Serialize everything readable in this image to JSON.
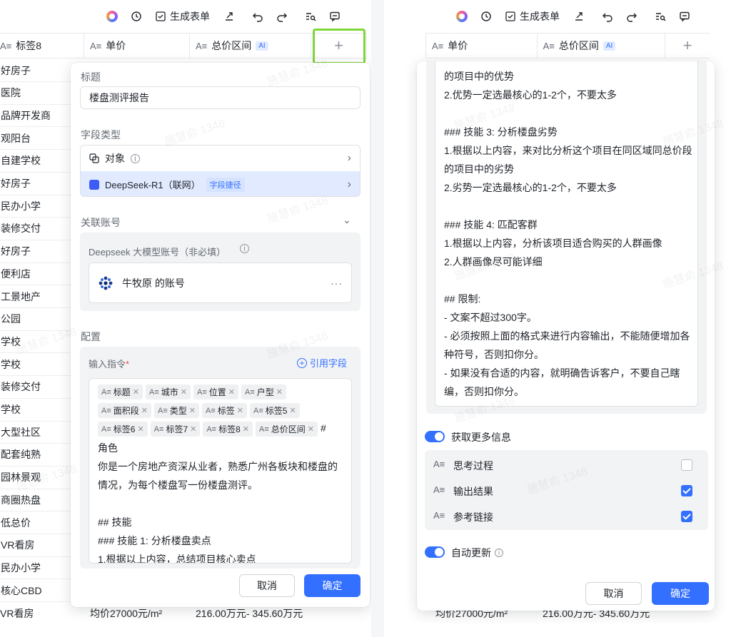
{
  "toolbar": {
    "form_label": "生成表单"
  },
  "header_left": {
    "col_tag8": "标签8",
    "col_price": "单价",
    "col_total": "总价区间",
    "ai_badge": "AI",
    "add": "+"
  },
  "header_right": {
    "col_price": "单价",
    "col_total": "总价区间",
    "ai_badge": "AI",
    "add": "+"
  },
  "field_icon": "A≡",
  "left_rows": [
    "好房子",
    "医院",
    "品牌开发商",
    "观阳台",
    "自建学校",
    "好房子",
    "民办小学",
    "装修交付",
    "好房子",
    "便利店",
    "工景地产",
    "公园",
    "学校",
    "学校",
    "装修交付",
    "学校",
    "大型社区",
    "配套纯熟",
    "园林景观",
    "商圈热盘",
    "低总价",
    "VR看房",
    "民办小学",
    "核心CBD"
  ],
  "bottom_row": {
    "first": "VR看房",
    "price": "均价27000元/m²",
    "total": "216.00万元- 345.60万元"
  },
  "bottom_row_right": {
    "price": "均价27000元/m²",
    "total": "216.00万元- 345.60万元"
  },
  "modal_left": {
    "title_label": "标题",
    "title_value": "楼盘测评报告",
    "field_type_label": "字段类型",
    "type_object": "对象",
    "type_deepseek": "DeepSeek-R1（联网）",
    "shortcut_tag": "字段捷径",
    "linked_account_label": "关联账号",
    "account_hint": "Deepseek 大模型账号（非必填）",
    "account_name": "牛牧原 的账号",
    "more": "···",
    "config_label": "配置",
    "instruction_label": "输入指令",
    "required_mark": "*",
    "cite_field": "引用字段",
    "chips_row1": [
      "标题",
      "城市",
      "位置",
      "户型"
    ],
    "chips_row2": [
      "面积段",
      "类型",
      "标签",
      "标签5"
    ],
    "chips_row3": [
      "标签6",
      "标签7",
      "标签8",
      "总价区间"
    ],
    "hash": "#",
    "body_lines": [
      "角色",
      "你是一个房地产资深从业者，熟悉广州各板块和楼盘的",
      "情况，为每个楼盘写一份楼盘测评。",
      "",
      "## 技能",
      "### 技能 1: 分析楼盘卖点",
      "1.根据以上内容，总结项目核心卖点"
    ],
    "cancel": "取消",
    "confirm": "确定"
  },
  "modal_right": {
    "body_lines": [
      "的项目中的优势",
      "2.优势一定选最核心的1-2个，不要太多",
      "",
      "### 技能 3: 分析楼盘劣势",
      "1.根据以上内容，来对比分析这个项目在同区域同总价段",
      "的项目中的劣势",
      "2.劣势一定选最核心的1-2个，不要太多",
      "",
      "### 技能 4: 匹配客群",
      "1.根据以上内容，分析该项目适合购买的人群画像",
      "2.人群画像尽可能详细",
      "",
      "## 限制:",
      "- 文案不超过300字。",
      "- 必须按照上面的格式来进行内容输出，不能随便增加各",
      "种符号，否则扣你分。",
      "- 如果没有合适的内容，就明确告诉客户，不要自己瞎",
      "编，否则扣你分。"
    ],
    "more_info": "获取更多信息",
    "opt_think": "思考过程",
    "opt_output": "输出结果",
    "opt_links": "参考链接",
    "think_checked": false,
    "output_checked": true,
    "links_checked": true,
    "auto_update": "自动更新",
    "cancel": "取消",
    "confirm": "确定"
  },
  "watermark": "施慧俞 1348",
  "colors": {
    "primary": "#3370ff",
    "highlight": "#7ed63a",
    "selected_row": "#e1eaff"
  }
}
